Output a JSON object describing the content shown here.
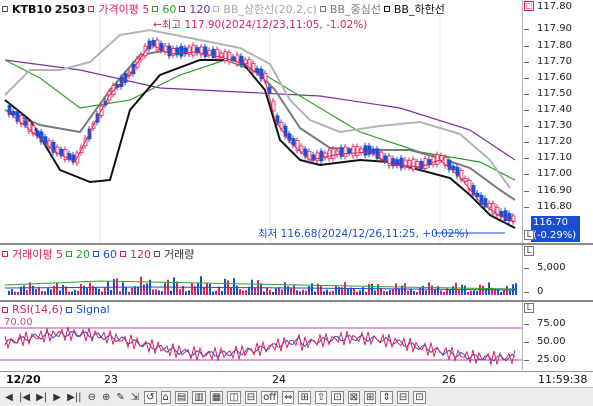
{
  "price_panel": {
    "symbol": "KTB10",
    "code": "2503",
    "legend": [
      {
        "label": "가격이평 5",
        "color": "#e0215a"
      },
      {
        "label": "60",
        "color": "#2fa02f"
      },
      {
        "label": "120",
        "color": "#7b2fa3"
      },
      {
        "label": "BB_상한선(20,2,c)",
        "color": "#b4b4b4"
      },
      {
        "label": "BB_중심선",
        "color": "#7a7a7a"
      },
      {
        "label": "BB_하한선",
        "color": "#111111"
      }
    ],
    "high_annotation": "←최고 117.90(2024/12/23,11:05, -1.02%)",
    "low_annotation": "최저 116.68(2024/12/26,11:25, +0.02%)",
    "low_arrow": "→",
    "y_ticks": [
      "117.80",
      "117.90",
      "117.80",
      "117.70",
      "117.60",
      "117.50",
      "117.40",
      "117.30",
      "117.20",
      "117.10",
      "117.00",
      "116.90",
      "116.80"
    ],
    "current_price": "116.70",
    "current_change": "(-0.29%)",
    "colors": {
      "up": "#e0215a",
      "down": "#1a4fd1",
      "ma5": "#e0215a",
      "ma60": "#2fa02f",
      "ma120": "#7b2fa3",
      "bb_upper": "#b4b4b4",
      "bb_mid": "#7a7a7a",
      "bb_lower": "#111111"
    }
  },
  "volume_panel": {
    "legend": [
      {
        "label": "거래이평 5",
        "color": "#e0215a"
      },
      {
        "label": "20",
        "color": "#2fa02f"
      },
      {
        "label": "60",
        "color": "#1a4fd1"
      },
      {
        "label": "120",
        "color": "#e0215a"
      },
      {
        "label": "거래량",
        "color": "#555555"
      }
    ],
    "y_ticks": [
      "5,000",
      "0"
    ]
  },
  "rsi_panel": {
    "legend": [
      {
        "label": "RSI(14,6)",
        "color": "#e0215a"
      },
      {
        "label": "Signal",
        "color": "#1a4fd1"
      }
    ],
    "level_label": "70.00",
    "y_ticks": [
      "75.00",
      "50.00",
      "25.00"
    ]
  },
  "time_axis": {
    "labels": [
      "12/20",
      "23",
      "24",
      "26"
    ],
    "clock": "11:59:38"
  },
  "toolbar": {
    "items": [
      "◀",
      "|◀",
      "▶|",
      "▶",
      "▶||",
      "⊖",
      "⊕",
      "✎",
      "⇲",
      "↺",
      "⌂",
      "▤",
      "▥",
      "▦",
      "◫",
      "⊟",
      "off",
      "⇔",
      "⊞",
      "⇧",
      "⊡",
      "⊠",
      "⊞",
      "⇕",
      "⊟",
      "⊡"
    ]
  }
}
